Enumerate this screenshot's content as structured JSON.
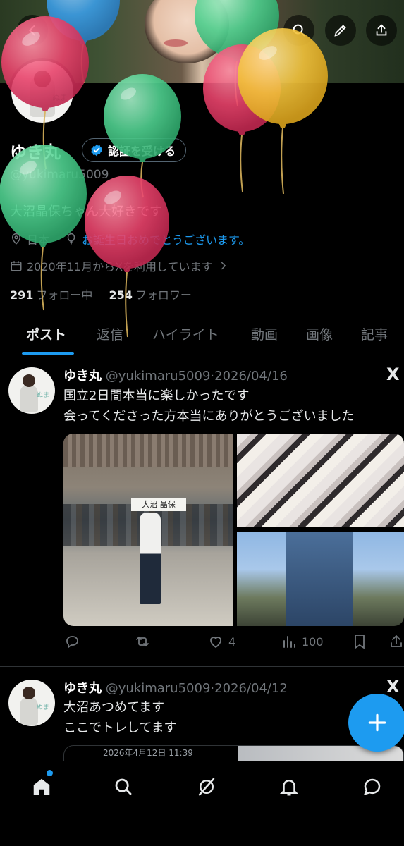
{
  "header": {
    "back_icon": "arrow-left-icon",
    "search_icon": "search-icon",
    "edit_icon": "pencil-icon",
    "share_icon": "share-icon"
  },
  "profile": {
    "name": "ゆき丸",
    "verify_label": "認証を受ける",
    "handle": "@yukimaru5009",
    "bio": "大沼晶保ちゃん大好きです",
    "location": "日本",
    "birthday_text": "お誕生日おめでとうございます。",
    "joined": "2020年11月からXを利用しています",
    "following_count": "291",
    "following_label": "フォロー中",
    "followers_count": "254",
    "followers_label": "フォロワー"
  },
  "tabs": [
    {
      "label": "ポスト"
    },
    {
      "label": "返信"
    },
    {
      "label": "ハイライト"
    },
    {
      "label": "動画"
    },
    {
      "label": "画像"
    },
    {
      "label": "記事"
    }
  ],
  "posts": [
    {
      "name": "ゆき丸",
      "handle": "@yukimaru5009",
      "date": "·2026/04/16",
      "text": [
        "国立2日間本当に楽しかったです",
        "会ってくださった方本当にありがとうございました"
      ],
      "image_sign": "大沼 晶保",
      "likes": "4",
      "views": "100"
    },
    {
      "name": "ゆき丸",
      "handle": "@yukimaru5009",
      "date": "·2026/04/12",
      "text": [
        "大沼あつめてます",
        "ここでトレしてます"
      ],
      "quote_time": "2026年4月12日 11:39"
    }
  ],
  "avatar_tag": "ぬま",
  "grok_glyph": "X",
  "colors": {
    "accent": "#1d9bf0",
    "background": "#000000",
    "balloon_red": "#e8436b",
    "balloon_green": "#4fd08f",
    "balloon_blue": "#3b9de6",
    "balloon_yellow": "#f2c23a"
  }
}
